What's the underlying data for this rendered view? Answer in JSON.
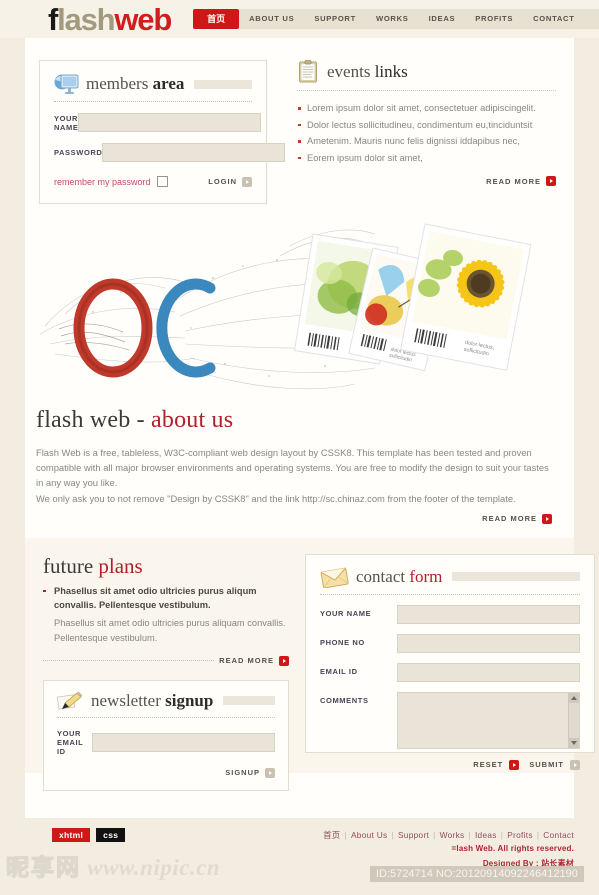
{
  "header": {
    "logo": {
      "part1": "f",
      "part2": "lash",
      "part3": "web"
    },
    "nav": [
      {
        "label": "首页",
        "active": true
      },
      {
        "label": "ABOUT US",
        "active": false
      },
      {
        "label": "SUPPORT",
        "active": false
      },
      {
        "label": "WORKS",
        "active": false
      },
      {
        "label": "IDEAS",
        "active": false
      },
      {
        "label": "PROFITS",
        "active": false
      },
      {
        "label": "CONTACT",
        "active": false
      }
    ]
  },
  "members": {
    "title_light": "members ",
    "title_bold": "area",
    "name_label": "YOUR NAME",
    "name_value": "",
    "password_label": "PASSWORD",
    "password_value": "",
    "remember_label": "remember my password",
    "login_label": "LOGIN"
  },
  "events": {
    "title_light": "events ",
    "title_bold": "links",
    "items": [
      "Lorem ipsum dolor sit amet, consectetuer adipiscingelit.",
      "Dolor lectus sollicitudineu, condimentum eu,tinciduntsit",
      "Ametenim. Mauris nunc felis dignissi iddapibus nec,",
      "Eorem ipsum dolor sit amet,"
    ],
    "read_more": "READ MORE"
  },
  "about": {
    "title_light": "flash web - ",
    "title_red": "about us",
    "paragraph1": "Flash Web is a free, tableless, W3C-compliant web design layout by CSSK8. This template has been tested and proven compatible with all major browser environments and operating systems. You are free to modify the design to suit your tastes in any way you like.",
    "paragraph2": "We only ask you to not remove \"Design by CSSK8\" and the link http://sc.chinaz.com from the footer of the template.",
    "read_more": "READ MORE"
  },
  "future_plans": {
    "title_light": "future ",
    "title_red": "plans",
    "bold_text": "Phasellus sit amet odio ultricies purus aliqum convallis. Pellentesque vestibulum.",
    "normal_text": "Phasellus sit amet odio ultricies purus aliquam convallis. Pellentesque vestibulum.",
    "read_more": "READ MORE"
  },
  "newsletter": {
    "title_light": "newsletter ",
    "title_bold": "signup",
    "email_label": "YOUR EMAIL ID",
    "email_value": "",
    "signup_label": "SIGNUP"
  },
  "contact": {
    "title_light": "contact ",
    "title_red": "form",
    "name_label": "YOUR NAME",
    "name_value": "",
    "phone_label": "PHONE NO",
    "phone_value": "",
    "email_label": "EMAIL ID",
    "email_value": "",
    "comments_label": "COMMENTS",
    "comments_value": "",
    "reset_label": "RESET",
    "submit_label": "SUBMIT"
  },
  "footer": {
    "badge_xhtml": "xhtml",
    "badge_css": "css",
    "links": [
      "首页",
      "About Us",
      "Support",
      "Works",
      "Ideas",
      "Profits",
      "Contact"
    ],
    "copyright": "=lash Web. All rights reserved.",
    "designed_by": "Designed By : 站长素材"
  },
  "watermark": {
    "site_cjk": "昵享网",
    "site_url": "www.nipic.cn",
    "id_text": "ID:5724714 NO:20120914092246412190"
  },
  "colors": {
    "accent_red": "#cf1717",
    "brand_tan": "#a39a7e",
    "page_bg": "#f2ece1",
    "panel_bg": "#faf6ed",
    "input_bg": "#e9e4d7"
  }
}
